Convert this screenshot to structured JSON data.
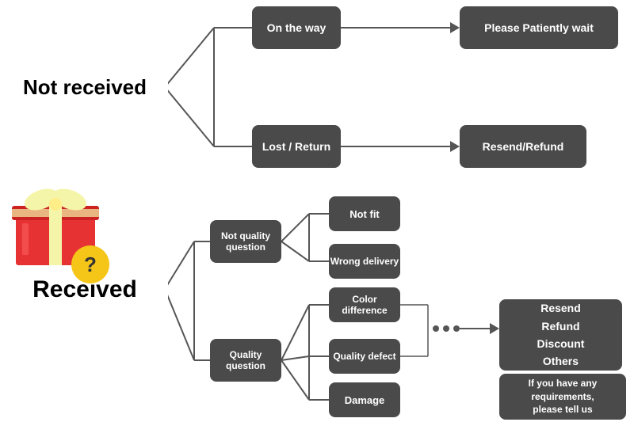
{
  "nodes": {
    "not_received": {
      "label": "Not received"
    },
    "on_the_way": {
      "label": "On the way"
    },
    "please_wait": {
      "label": "Please Patiently wait"
    },
    "lost_return": {
      "label": "Lost / Return"
    },
    "resend_refund_top": {
      "label": "Resend/Refund"
    },
    "received": {
      "label": "Received"
    },
    "not_quality": {
      "label": "Not quality\nquestion"
    },
    "quality_question": {
      "label": "Quality question"
    },
    "not_fit": {
      "label": "Not fit"
    },
    "wrong_delivery": {
      "label": "Wrong delivery"
    },
    "color_difference": {
      "label": "Color difference"
    },
    "quality_defect": {
      "label": "Quality defect"
    },
    "damage": {
      "label": "Damage"
    },
    "resend_refund_discount": {
      "label": "Resend\nRefund\nDiscount\nOthers"
    },
    "requirements": {
      "label": "If you have any\nrequirements,\nplease tell us"
    }
  },
  "colors": {
    "dark_node": "#4a4a4a",
    "node_text": "#ffffff",
    "arrow": "#555555",
    "large_text": "#000000"
  }
}
